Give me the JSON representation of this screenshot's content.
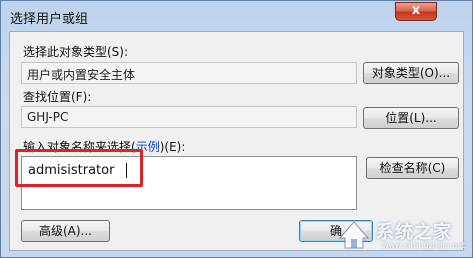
{
  "window": {
    "title": "选择用户或组",
    "close_glyph": "x"
  },
  "object_type": {
    "label": "选择此对象类型(S):",
    "value": "用户或内置安全主体",
    "button": "对象类型(O)..."
  },
  "location": {
    "label": "查找位置(F):",
    "value": "GHJ-PC",
    "button": "位置(L)..."
  },
  "names": {
    "label_prefix": "输入对象名称来选择(",
    "label_link": "示例",
    "label_suffix": ")(E):",
    "input_value": "admisistrator",
    "check_button": "检查名称(C)"
  },
  "footer": {
    "advanced_button": "高级(A)...",
    "ok_button": "确"
  },
  "watermark": {
    "text": "系统之家",
    "url": "www.xitongzhijia.net"
  },
  "colors": {
    "highlight": "#d9252a",
    "link": "#0645c6",
    "close": "#c2391c"
  }
}
